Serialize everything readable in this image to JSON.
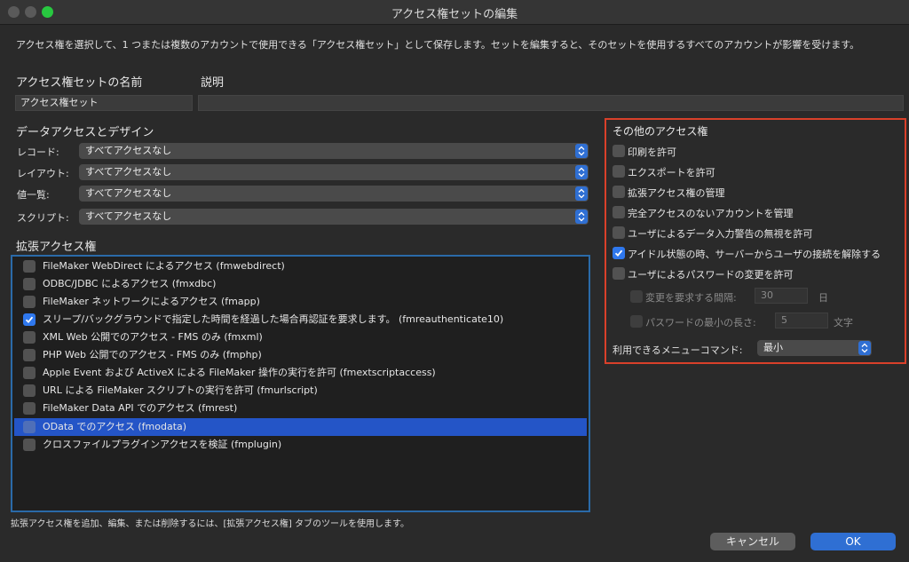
{
  "window": {
    "title": "アクセス権セットの編集"
  },
  "description": "アクセス権を選択して、1 つまたは複数のアカウントで使用できる「アクセス権セット」として保存します。セットを編集すると、そのセットを使用するすべてのアカウントが影響を受けます。",
  "name_field": {
    "label": "アクセス権セットの名前",
    "value": "アクセス権セット"
  },
  "desc_field": {
    "label": "説明",
    "value": ""
  },
  "data_access": {
    "title": "データアクセスとデザイン",
    "rows": [
      {
        "label": "レコード:",
        "value": "すべてアクセスなし"
      },
      {
        "label": "レイアウト:",
        "value": "すべてアクセスなし"
      },
      {
        "label": "値一覧:",
        "value": "すべてアクセスなし"
      },
      {
        "label": "スクリプト:",
        "value": "すべてアクセスなし"
      }
    ]
  },
  "extended": {
    "title": "拡張アクセス権",
    "items": [
      {
        "label": "FileMaker WebDirect によるアクセス (fmwebdirect)",
        "checked": false,
        "selected": false
      },
      {
        "label": "ODBC/JDBC によるアクセス (fmxdbc)",
        "checked": false,
        "selected": false
      },
      {
        "label": "FileMaker ネットワークによるアクセス (fmapp)",
        "checked": false,
        "selected": false
      },
      {
        "label": "スリープ/バックグラウンドで指定した時間を経過した場合再認証を要求します。 (fmreauthenticate10)",
        "checked": true,
        "selected": false
      },
      {
        "label": "XML Web 公開でのアクセス - FMS のみ (fmxml)",
        "checked": false,
        "selected": false
      },
      {
        "label": "PHP Web 公開でのアクセス - FMS のみ (fmphp)",
        "checked": false,
        "selected": false
      },
      {
        "label": "Apple Event および ActiveX による FileMaker 操作の実行を許可 (fmextscriptaccess)",
        "checked": false,
        "selected": false
      },
      {
        "label": "URL による FileMaker スクリプトの実行を許可 (fmurlscript)",
        "checked": false,
        "selected": false
      },
      {
        "label": "FileMaker Data API でのアクセス (fmrest)",
        "checked": false,
        "selected": false
      },
      {
        "label": "OData でのアクセス (fmodata)",
        "checked": false,
        "selected": true
      },
      {
        "label": "クロスファイルプラグインアクセスを検証 (fmplugin)",
        "checked": false,
        "selected": false
      }
    ],
    "footnote": "拡張アクセス権を追加、編集、または削除するには、[拡張アクセス権] タブのツールを使用します。"
  },
  "other": {
    "title": "その他のアクセス権",
    "items": [
      {
        "label": "印刷を許可",
        "checked": false
      },
      {
        "label": "エクスポートを許可",
        "checked": false
      },
      {
        "label": "拡張アクセス権の管理",
        "checked": false
      },
      {
        "label": "完全アクセスのないアカウントを管理",
        "checked": false
      },
      {
        "label": "ユーザによるデータ入力警告の無視を許可",
        "checked": false
      },
      {
        "label": "アイドル状態の時、サーバーからユーザの接続を解除する",
        "checked": true
      },
      {
        "label": "ユーザによるパスワードの変更を許可",
        "checked": false
      }
    ],
    "change_interval": {
      "label": "変更を要求する間隔:",
      "value": "30",
      "unit": "日"
    },
    "min_length": {
      "label": "パスワードの最小の長さ:",
      "value": "5",
      "unit": "文字"
    },
    "menu_commands": {
      "label": "利用できるメニューコマンド:",
      "value": "最小"
    }
  },
  "buttons": {
    "cancel": "キャンセル",
    "ok": "OK"
  },
  "colors": {
    "accent": "#2f6fd3",
    "highlight_red": "#d9402a",
    "highlight_blue": "#2a6aa8",
    "selection": "#2455c7"
  }
}
